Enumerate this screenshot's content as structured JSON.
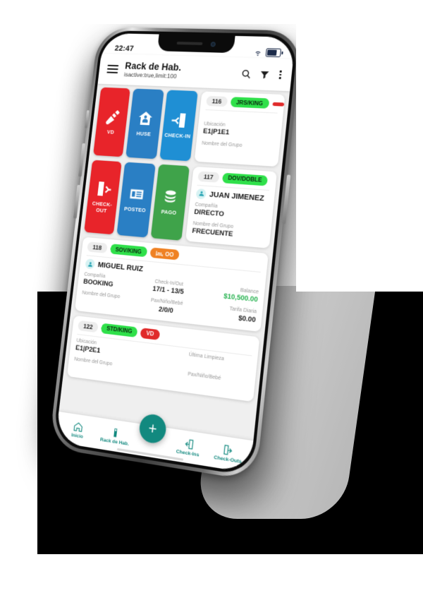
{
  "status_bar": {
    "time": "22:47",
    "wifi_icon": "wifi-icon",
    "battery_icon": "battery-icon"
  },
  "app_bar": {
    "menu_icon": "hamburger-menu-icon",
    "title": "Rack de Hab.",
    "subtitle": "isactive:true,limit:100",
    "search_icon": "search-icon",
    "filter_icon": "filter-funnel-icon",
    "overflow_icon": "kebab-menu-icon"
  },
  "action_rows": [
    {
      "tiles": [
        {
          "label": "VD",
          "icon": "broom-icon",
          "color": "#e8242a"
        },
        {
          "label": "HUSE",
          "icon": "house-icon",
          "color": "#2a7fc4"
        },
        {
          "label": "CHECK-IN",
          "icon": "check-in-door-icon",
          "color": "#1f8fd4"
        }
      ]
    },
    {
      "tiles": [
        {
          "label": "CHECK-OUT",
          "icon": "check-out-door-icon",
          "color": "#e8242a"
        },
        {
          "label": "POSTEO",
          "icon": "receipt-icon",
          "color": "#2a7fc4"
        },
        {
          "label": "PAGO",
          "icon": "coins-icon",
          "color": "#3fa34a"
        }
      ]
    }
  ],
  "rooms": [
    {
      "number": "116",
      "type_badge": "JRS/KING",
      "status_badge": "",
      "status_badge_color": "#e02a2a",
      "fields": {
        "ubicacion_label": "Ubicación",
        "ubicacion_value": "E1|P1E1",
        "grupo_label": "Nombre del Grupo",
        "grupo_value": ""
      }
    },
    {
      "number": "117",
      "type_badge": "DOV/DOBLE",
      "guest_name": "JUAN JIMENEZ",
      "fields": {
        "compania_label": "Compañía",
        "compania_value": "DIRECTO",
        "grupo_label": "Nombre del Grupo",
        "grupo_value": "FRECUENTE"
      }
    },
    {
      "number": "118",
      "type_badge": "SOV/KING",
      "occupancy_badge": "OO",
      "occupancy_icon": "bed-icon",
      "guest_name": "MIGUEL RUIZ",
      "fields": {
        "compania_label": "Compañía",
        "compania_value": "BOOKING",
        "checkinout_label": "Check-In/Out",
        "checkinout_value": "17/1 - 13/5",
        "balance_label": "Balance",
        "balance_value": "$10,500.00",
        "grupo_label": "Nombre del Grupo",
        "grupo_value": "",
        "pax_label": "Pax/Niño/Bebé",
        "pax_value": "2/0/0",
        "tarifa_label": "Tarifa Diaria",
        "tarifa_value": "$0.00"
      }
    },
    {
      "number": "122",
      "type_badge": "STD/KING",
      "status_badge": "VD",
      "fields": {
        "ubicacion_label": "Ubicación",
        "ubicacion_value": "E1|P2E1",
        "limpieza_label": "Última Limpieza",
        "limpieza_value": "",
        "grupo_label": "Nombre del Grupo",
        "grupo_value": "",
        "pax_label": "Pax/Niño/Bebé",
        "pax_value": ""
      }
    }
  ],
  "bottom_nav": {
    "items": [
      {
        "label": "Inicio",
        "icon": "home-icon"
      },
      {
        "label": "Rack de Hab.",
        "icon": "door-hanger-icon"
      },
      {
        "label": "Check-Ins",
        "icon": "check-in-door-icon"
      },
      {
        "label": "Check-Outs",
        "icon": "check-out-door-icon"
      }
    ],
    "fab_label": "+",
    "fab_icon": "plus-icon",
    "accent_color": "#12897f"
  }
}
